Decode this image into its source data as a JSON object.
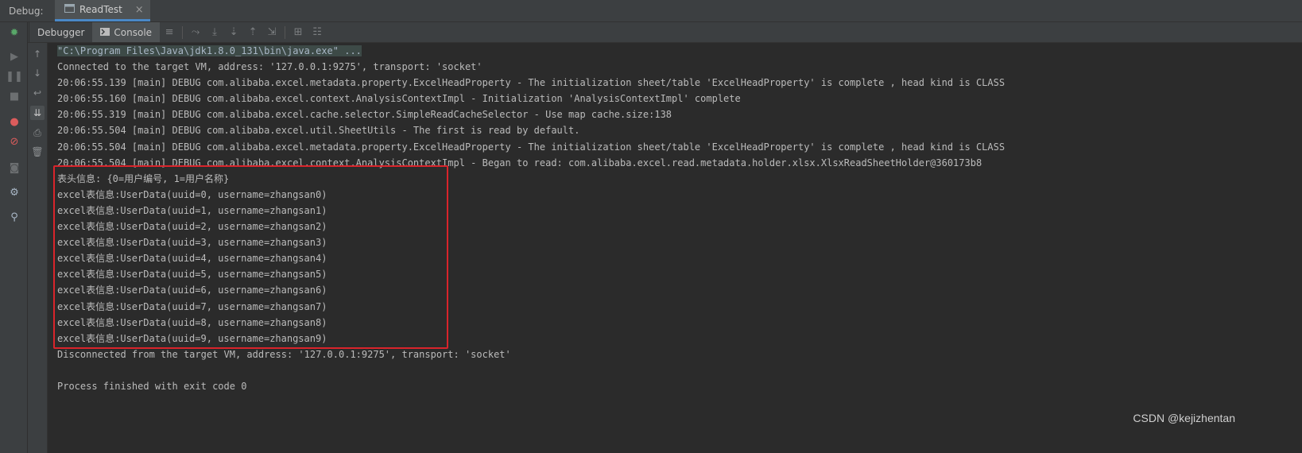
{
  "titlebar": {
    "debug_label": "Debug:",
    "tab_label": "ReadTest",
    "tab_close": "×"
  },
  "toolbar": {
    "debugger_tab": "Debugger",
    "console_tab": "Console"
  },
  "console": {
    "command": "\"C:\\Program Files\\Java\\jdk1.8.0_131\\bin\\java.exe\" ...",
    "lines": [
      "Connected to the target VM, address: '127.0.0.1:9275', transport: 'socket'",
      "20:06:55.139 [main] DEBUG com.alibaba.excel.metadata.property.ExcelHeadProperty - The initialization sheet/table 'ExcelHeadProperty' is complete , head kind is CLASS",
      "20:06:55.160 [main] DEBUG com.alibaba.excel.context.AnalysisContextImpl - Initialization 'AnalysisContextImpl' complete",
      "20:06:55.319 [main] DEBUG com.alibaba.excel.cache.selector.SimpleReadCacheSelector - Use map cache.size:138",
      "20:06:55.504 [main] DEBUG com.alibaba.excel.util.SheetUtils - The first is read by default.",
      "20:06:55.504 [main] DEBUG com.alibaba.excel.metadata.property.ExcelHeadProperty - The initialization sheet/table 'ExcelHeadProperty' is complete , head kind is CLASS",
      "20:06:55.504 [main] DEBUG com.alibaba.excel.context.AnalysisContextImpl - Began to read: com.alibaba.excel.read.metadata.holder.xlsx.XlsxReadSheetHolder@360173b8",
      "表头信息: {0=用户编号, 1=用户名称}",
      "excel表信息:UserData(uuid=0, username=zhangsan0)",
      "excel表信息:UserData(uuid=1, username=zhangsan1)",
      "excel表信息:UserData(uuid=2, username=zhangsan2)",
      "excel表信息:UserData(uuid=3, username=zhangsan3)",
      "excel表信息:UserData(uuid=4, username=zhangsan4)",
      "excel表信息:UserData(uuid=5, username=zhangsan5)",
      "excel表信息:UserData(uuid=6, username=zhangsan6)",
      "excel表信息:UserData(uuid=7, username=zhangsan7)",
      "excel表信息:UserData(uuid=8, username=zhangsan8)",
      "excel表信息:UserData(uuid=9, username=zhangsan9)",
      "Disconnected from the target VM, address: '127.0.0.1:9275', transport: 'socket'",
      "",
      "Process finished with exit code 0"
    ]
  },
  "watermark": "CSDN @kejizhentan",
  "colors": {
    "highlight_border": "#d9242b",
    "accent_tab": "#4a88c7",
    "background": "#2b2b2b"
  },
  "icons": {
    "left_strip": [
      "bug-icon",
      "resume-icon",
      "pause-icon",
      "stop-icon",
      "breakpoints-icon",
      "mute-breakpoints-icon",
      "camera-icon",
      "settings-icon",
      "pin-icon"
    ],
    "gutter": [
      "up-arrow-icon",
      "down-arrow-icon",
      "soft-wrap-icon",
      "scroll-to-end-icon",
      "print-icon",
      "trash-icon"
    ]
  }
}
